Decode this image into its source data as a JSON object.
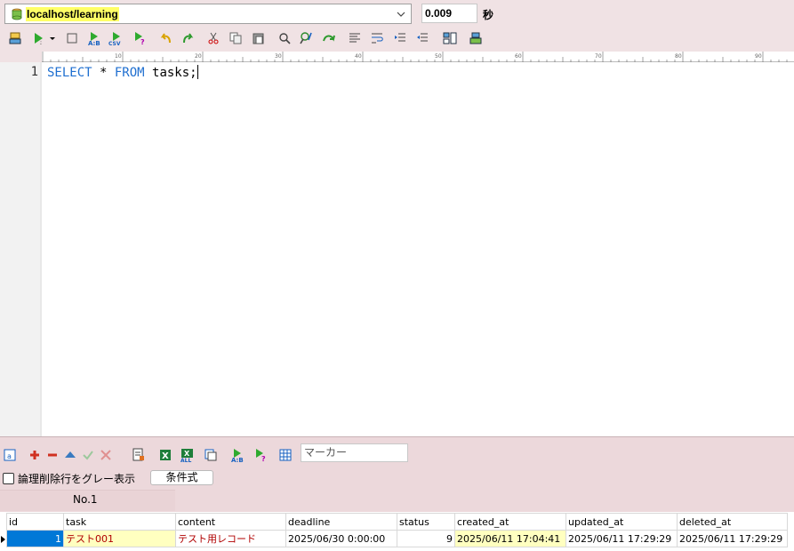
{
  "connection": {
    "label": "localhost/learning"
  },
  "timer": {
    "value": "0.009",
    "unit": "秒"
  },
  "ruler": {
    "ticks": [
      "10",
      "20",
      "30",
      "40",
      "50",
      "60",
      "70",
      "80",
      "90"
    ]
  },
  "editor": {
    "line_number": "1",
    "code": {
      "kw1": "SELECT",
      "star": " * ",
      "kw2": "FROM",
      "rest": " tasks;"
    }
  },
  "grid_toolbar": {
    "marker_placeholder": "マーカー"
  },
  "options": {
    "show_deleted_gray": "論理削除行をグレー表示",
    "condition_button": "条件式"
  },
  "result_tab": {
    "label": "No.1"
  },
  "table": {
    "columns": [
      "id",
      "task",
      "content",
      "deadline",
      "status",
      "created_at",
      "updated_at",
      "deleted_at"
    ],
    "rows": [
      [
        "1",
        "テスト001",
        "テスト用レコード",
        "2025/06/30 0:00:00",
        "9",
        "2025/06/11 17:04:41",
        "2025/06/11 17:29:29",
        "2025/06/11 17:29:29"
      ]
    ]
  },
  "colors": {
    "accent": "#0078d7",
    "highlight": "#ffff66",
    "panel": "#f0e2e4"
  }
}
